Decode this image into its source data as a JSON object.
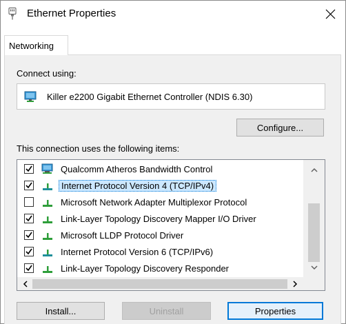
{
  "window": {
    "title": "Ethernet Properties"
  },
  "tabs": [
    {
      "label": "Networking"
    }
  ],
  "connect_using": {
    "label": "Connect using:",
    "adapter_name": "Killer e2200 Gigabit Ethernet Controller (NDIS 6.30)",
    "configure_label": "Configure..."
  },
  "items_section": {
    "label": "This connection uses the following items:",
    "items": [
      {
        "label": "Qualcomm Atheros Bandwidth Control",
        "checked": true,
        "icon": "network-adapter-icon",
        "selected": false
      },
      {
        "label": "Internet Protocol Version 4 (TCP/IPv4)",
        "checked": true,
        "icon": "protocol-icon",
        "selected": true
      },
      {
        "label": "Microsoft Network Adapter Multiplexor Protocol",
        "checked": false,
        "icon": "protocol-icon",
        "selected": false
      },
      {
        "label": "Link-Layer Topology Discovery Mapper I/O Driver",
        "checked": true,
        "icon": "protocol-icon",
        "selected": false
      },
      {
        "label": "Microsoft LLDP Protocol Driver",
        "checked": true,
        "icon": "protocol-icon",
        "selected": false
      },
      {
        "label": "Internet Protocol Version 6 (TCP/IPv6)",
        "checked": true,
        "icon": "protocol-icon",
        "selected": false
      },
      {
        "label": "Link-Layer Topology Discovery Responder",
        "checked": true,
        "icon": "protocol-icon",
        "selected": false
      }
    ]
  },
  "buttons": {
    "install": "Install...",
    "uninstall": "Uninstall",
    "properties": "Properties"
  },
  "colors": {
    "selection_bg": "#cce8ff",
    "focus_border": "#0078d7",
    "protocol_green": "#2e9e3a",
    "protocol_teal": "#1f8f9a"
  }
}
